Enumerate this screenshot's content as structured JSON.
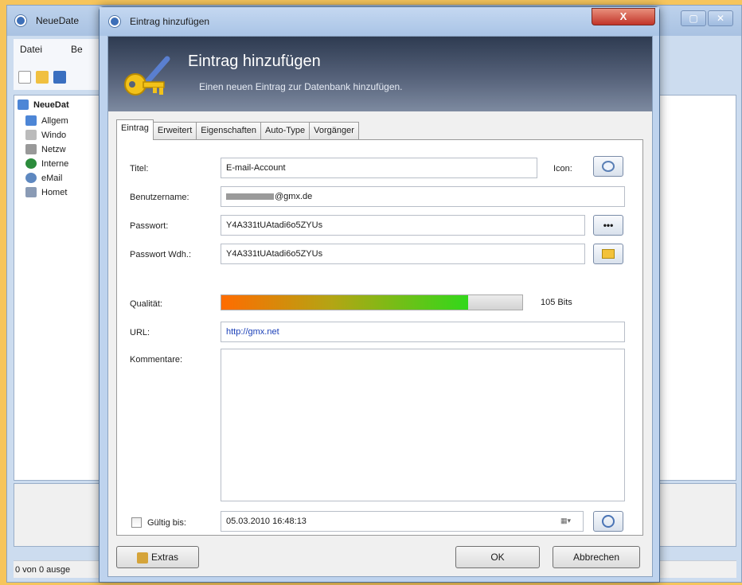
{
  "main_window": {
    "title": "NeueDate",
    "menu": [
      "Datei",
      "Be"
    ],
    "tree": {
      "root": "NeueDat",
      "items": [
        "Allgem",
        "Windo",
        "Netzw",
        "Interne",
        "eMail",
        "Homet"
      ]
    },
    "status": "0 von 0 ausge"
  },
  "dialog": {
    "title": "Eintrag hinzufügen",
    "close_label": "X",
    "banner": {
      "title": "Eintrag hinzufügen",
      "subtitle": "Einen neuen Eintrag zur Datenbank hinzufügen."
    },
    "tabs": [
      "Eintrag",
      "Erweitert",
      "Eigenschaften",
      "Auto-Type",
      "Vorgänger"
    ],
    "form": {
      "title_label": "Titel:",
      "title_value": "E-mail-Account",
      "icon_label": "Icon:",
      "username_label": "Benutzername:",
      "username_value": "@gmx.de",
      "password_label": "Passwort:",
      "password_value": "Y4A331tUAtadi6o5ZYUs",
      "password_toggle": "•••",
      "repeat_label": "Passwort Wdh.:",
      "repeat_value": "Y4A331tUAtadi6o5ZYUs",
      "quality_label": "Qualität:",
      "quality_fraction": 0.82,
      "quality_bits": "105 Bits",
      "url_label": "URL:",
      "url_value": "http://gmx.net",
      "comment_label": "Kommentare:",
      "expires_label": "Gültig bis:",
      "expires_value": "05.03.2010 16:48:13"
    },
    "buttons": {
      "extras": "Extras",
      "ok": "OK",
      "cancel": "Abbrechen"
    }
  }
}
